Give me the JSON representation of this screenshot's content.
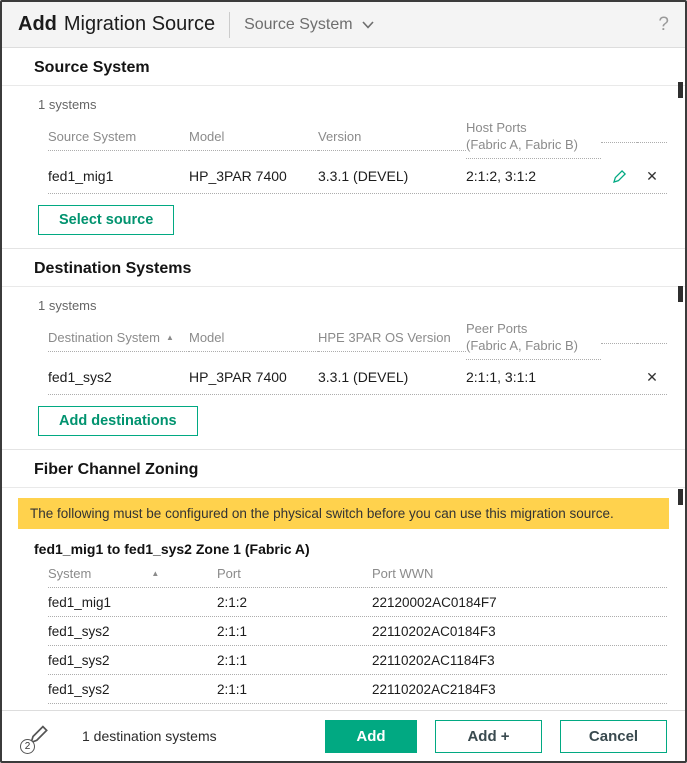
{
  "accent": "#01a982",
  "warning_bg": "#ffd24d",
  "icons": {
    "sort_asc": "▲",
    "close": "✕",
    "help": "?"
  },
  "header": {
    "title_bold": "Add",
    "title_rest": "Migration Source",
    "dropdown_label": "Source System"
  },
  "source_section": {
    "heading": "Source System",
    "count": "1 systems",
    "columns": [
      "Source System",
      "Model",
      "Version",
      "Host Ports",
      "(Fabric A, Fabric B)"
    ],
    "rows": [
      [
        "fed1_mig1",
        "HP_3PAR 7400",
        "3.3.1 (DEVEL)",
        "2:1:2, 3:1:2"
      ]
    ],
    "button": "Select source"
  },
  "destination_section": {
    "heading": "Destination Systems",
    "count": "1 systems",
    "columns": [
      "Destination System",
      "Model",
      "HPE 3PAR OS Version",
      "Peer Ports",
      "(Fabric A, Fabric B)"
    ],
    "rows": [
      [
        "fed1_sys2",
        "HP_3PAR 7400",
        "3.3.1 (DEVEL)",
        "2:1:1, 3:1:1"
      ]
    ],
    "button": "Add destinations"
  },
  "zoning_section": {
    "heading": "Fiber Channel Zoning",
    "warning": "The following must be configured on the physical switch before you can use this migration source.",
    "zone_title": "fed1_mig1 to fed1_sys2 Zone 1 (Fabric A)",
    "columns": [
      "System",
      "Port",
      "Port WWN"
    ],
    "rows": [
      [
        "fed1_mig1",
        "2:1:2",
        "22120002AC0184F7"
      ],
      [
        "fed1_sys2",
        "2:1:1",
        "22110202AC0184F3"
      ],
      [
        "fed1_sys2",
        "2:1:1",
        "22110202AC1184F3"
      ],
      [
        "fed1_sys2",
        "2:1:1",
        "22110202AC2184F3"
      ]
    ]
  },
  "footer": {
    "badge": "2",
    "status": "1 destination systems",
    "add_label": "Add",
    "add_plus_label": "Add +",
    "cancel_label": "Cancel"
  }
}
